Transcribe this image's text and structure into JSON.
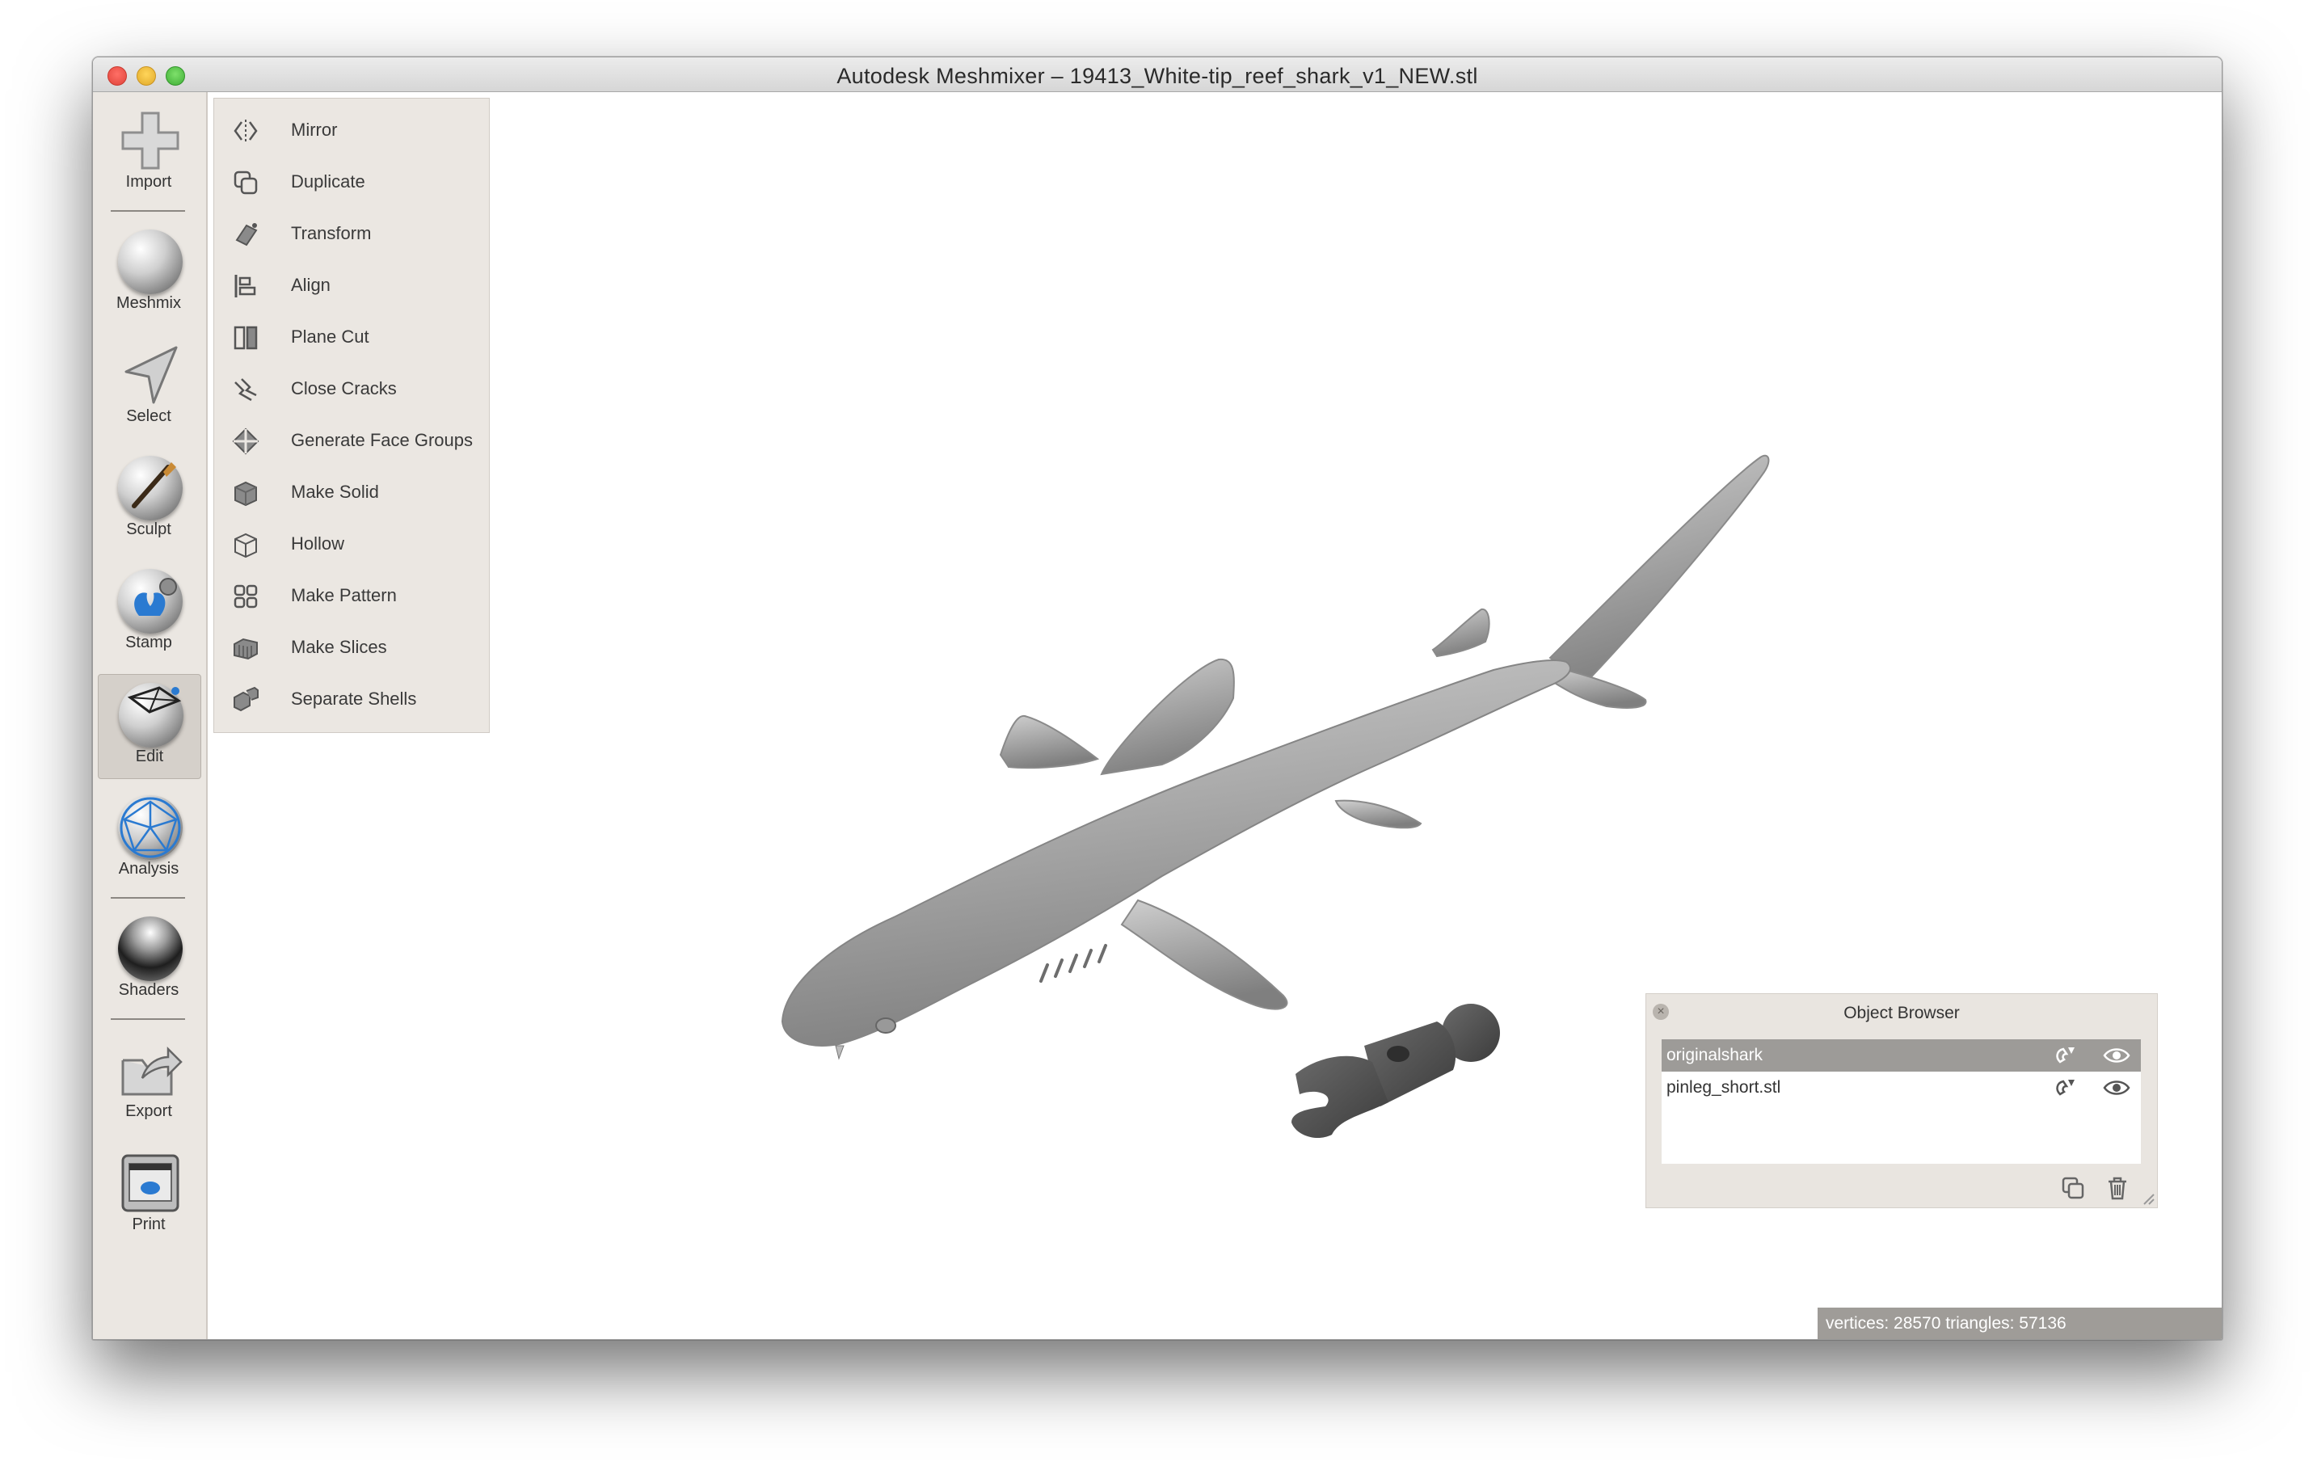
{
  "window": {
    "title": "Autodesk Meshmixer – 19413_White-tip_reef_shark_v1_NEW.stl"
  },
  "toolbar": {
    "items": [
      {
        "label": "Import",
        "icon": "plus-icon"
      },
      {
        "label": "Meshmix",
        "icon": "meshmix-face-icon"
      },
      {
        "label": "Select",
        "icon": "select-arrow-icon"
      },
      {
        "label": "Sculpt",
        "icon": "sculpt-brush-icon"
      },
      {
        "label": "Stamp",
        "icon": "stamp-icon"
      },
      {
        "label": "Edit",
        "icon": "edit-icon"
      },
      {
        "label": "Analysis",
        "icon": "analysis-icon"
      },
      {
        "label": "Shaders",
        "icon": "shaders-sphere-icon"
      },
      {
        "label": "Export",
        "icon": "export-icon"
      },
      {
        "label": "Print",
        "icon": "print-icon"
      }
    ],
    "active": "Edit"
  },
  "edit_menu": {
    "items": [
      {
        "label": "Mirror",
        "icon": "mirror-icon"
      },
      {
        "label": "Duplicate",
        "icon": "duplicate-icon"
      },
      {
        "label": "Transform",
        "icon": "transform-icon"
      },
      {
        "label": "Align",
        "icon": "align-icon"
      },
      {
        "label": "Plane Cut",
        "icon": "plane-cut-icon"
      },
      {
        "label": "Close Cracks",
        "icon": "close-cracks-icon"
      },
      {
        "label": "Generate Face Groups",
        "icon": "face-groups-icon"
      },
      {
        "label": "Make Solid",
        "icon": "make-solid-icon"
      },
      {
        "label": "Hollow",
        "icon": "hollow-icon"
      },
      {
        "label": "Make Pattern",
        "icon": "make-pattern-icon"
      },
      {
        "label": "Make Slices",
        "icon": "make-slices-icon"
      },
      {
        "label": "Separate Shells",
        "icon": "separate-shells-icon"
      }
    ]
  },
  "object_browser": {
    "title": "Object Browser",
    "objects": [
      {
        "name": "originalshark",
        "selected": true
      },
      {
        "name": "pinleg_short.stl",
        "selected": false
      }
    ]
  },
  "status": {
    "text": "vertices: 28570 triangles: 57136"
  },
  "colors": {
    "panel_bg": "#ebe7e2",
    "selection": "#9d9b98",
    "model_gray": "#a9a9a9",
    "accent_blue": "#2a7ad1"
  }
}
